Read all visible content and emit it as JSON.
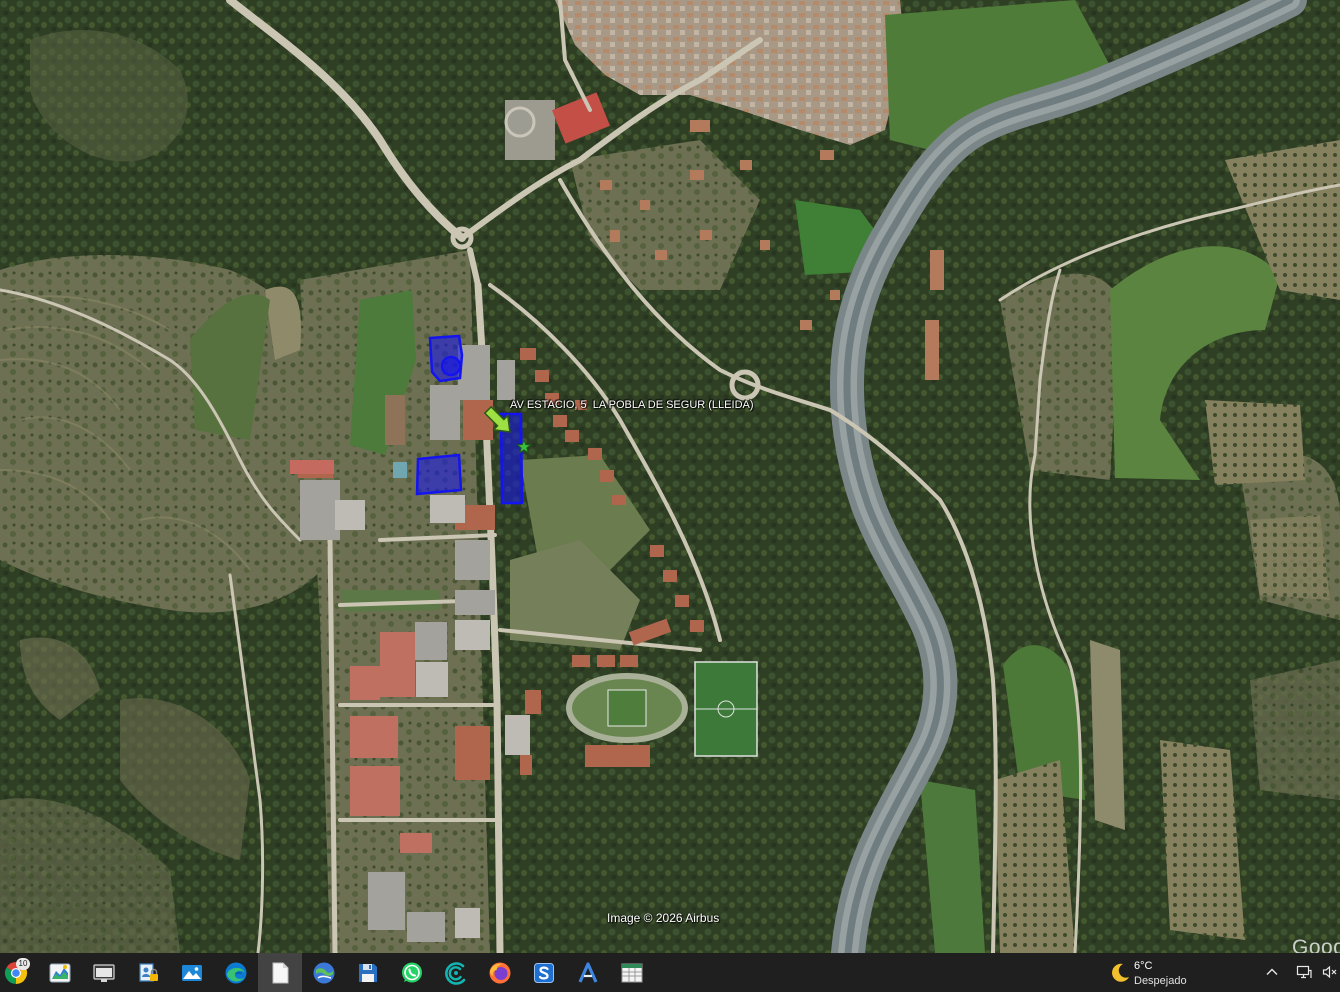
{
  "map": {
    "placemark": {
      "label": "AV ESTACIO, 5  LA POBLA DE SEGUR (LLEIDA)",
      "icon": "placemark-arrow-icon",
      "color": "#9ee044"
    },
    "star_marker": {
      "icon": "star-icon",
      "color": "#3cbf3c"
    },
    "polygon_color": "#1414f0",
    "attribution": "Image © 2026 Airbus",
    "watermark": "Google"
  },
  "taskbar": {
    "apps": [
      {
        "icon": "chrome-icon",
        "badge": "10"
      },
      {
        "icon": "chart-app-icon"
      },
      {
        "icon": "window-app-icon"
      },
      {
        "icon": "user-lock-icon"
      },
      {
        "icon": "photos-icon"
      },
      {
        "icon": "edge-icon"
      },
      {
        "icon": "document-icon",
        "active": true
      },
      {
        "icon": "google-earth-icon"
      },
      {
        "icon": "floppy-disk-icon"
      },
      {
        "icon": "whatsapp-icon"
      },
      {
        "icon": "signal-arcs-icon"
      },
      {
        "icon": "firefox-icon"
      },
      {
        "icon": "s-app-icon"
      },
      {
        "icon": "a-app-icon"
      },
      {
        "icon": "spreadsheet-window-icon"
      }
    ]
  },
  "weather": {
    "icon": "moon-icon",
    "temperature": "6°C",
    "condition": "Despejado"
  },
  "system_tray": {
    "icons": [
      "chevron-up-icon",
      "network-icon",
      "speaker-muted-icon"
    ]
  }
}
